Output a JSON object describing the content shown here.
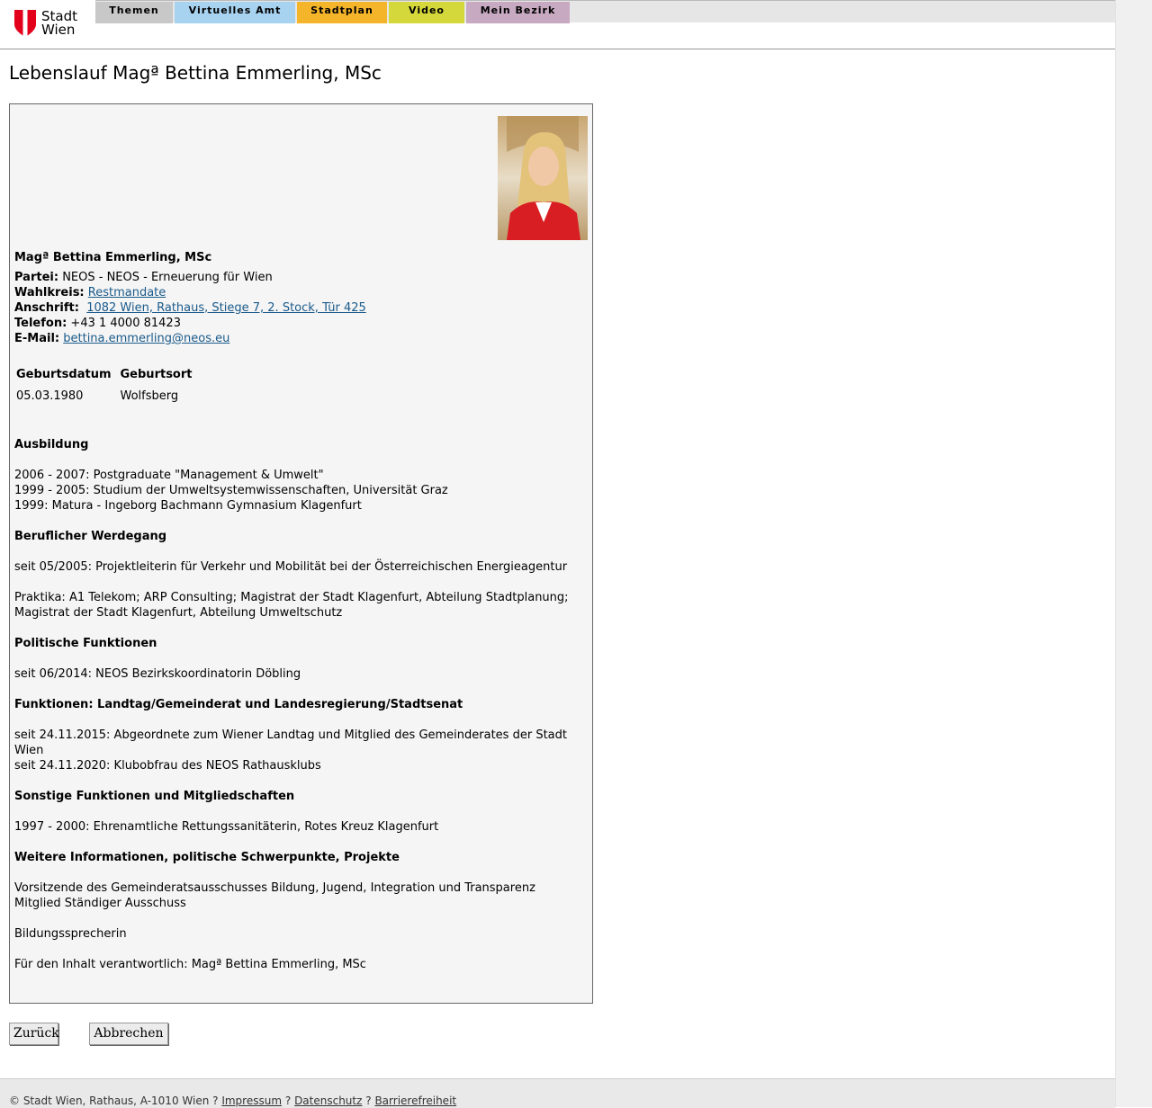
{
  "header": {
    "logo_text_line1": "Stadt",
    "logo_text_line2": "Wien",
    "tabs": [
      {
        "label": "Themen",
        "color": "#c8c8c8"
      },
      {
        "label": "Virtuelles Amt",
        "color": "#a8d3f0"
      },
      {
        "label": "Stadtplan",
        "color": "#f5b52a"
      },
      {
        "label": "Video",
        "color": "#d4d83a"
      },
      {
        "label": "Mein Bezirk",
        "color": "#c7a9c2"
      }
    ]
  },
  "page_title": "Lebenslauf Magª Bettina Emmerling, MSc",
  "profile": {
    "name": "Magª Bettina Emmerling, MSc",
    "partei_label": "Partei:",
    "partei_value": "NEOS - NEOS - Erneuerung für Wien",
    "wahlkreis_label": "Wahlkreis:",
    "wahlkreis_value": "Restmandate",
    "anschrift_label": "Anschrift:",
    "anschrift_value": "1082 Wien, Rathaus, Stiege 7, 2. Stock, Tür 425",
    "telefon_label": "Telefon:",
    "telefon_value": "+43 1 4000 81423",
    "email_label": "E-Mail:",
    "email_value": "bettina.emmerling@neos.eu"
  },
  "birth_table": {
    "headers": [
      "Geburtsdatum",
      "Geburtsort"
    ],
    "row": [
      "05.03.1980",
      "Wolfsberg"
    ]
  },
  "sections": {
    "ausbildung_title": "Ausbildung",
    "ausbildung": [
      "2006 - 2007: Postgraduate \"Management & Umwelt\"",
      "1999 - 2005: Studium der Umweltsystemwissenschaften, Universität Graz",
      "1999: Matura - Ingeborg Bachmann Gymnasium Klagenfurt"
    ],
    "beruf_title": "Beruflicher Werdegang",
    "beruf_1": "seit 05/2005: Projektleiterin für Verkehr und Mobilität bei der Österreichischen Energieagentur",
    "beruf_2": "Praktika: A1 Telekom; ARP Consulting; Magistrat der Stadt Klagenfurt, Abteilung Stadtplanung; Magistrat der Stadt Klagenfurt, Abteilung Umweltschutz",
    "politisch_title": "Politische Funktionen",
    "politisch_1": "seit 06/2014: NEOS Bezirkskoordinatorin Döbling",
    "funktionen_title": "Funktionen: Landtag/Gemeinderat und Landesregierung/Stadtsenat",
    "funktionen_1": "seit 24.11.2015: Abgeordnete zum Wiener Landtag und Mitglied des Gemeinderates der Stadt Wien",
    "funktionen_2": "seit 24.11.2020: Klubobfrau des NEOS Rathausklubs",
    "sonstige_title": "Sonstige Funktionen und Mitgliedschaften",
    "sonstige_1": "1997 - 2000: Ehrenamtliche Rettungssanitäterin, Rotes Kreuz Klagenfurt",
    "weitere_title": "Weitere Informationen, politische Schwerpunkte, Projekte",
    "weitere_1": "Vorsitzende des Gemeinderatsausschusses Bildung, Jugend, Integration und Transparenz",
    "weitere_2": "Mitglied Ständiger Ausschuss",
    "weitere_3": "Bildungssprecherin",
    "verantwortlich": "Für den Inhalt verantwortlich: Magª Bettina Emmerling, MSc"
  },
  "buttons": {
    "back": "Zurück",
    "cancel": "Abbrechen"
  },
  "footer": {
    "copyright": "© Stadt Wien, Rathaus, A-1010 Wien ?",
    "sep": "?",
    "impressum": "Impressum",
    "datenschutz": "Datenschutz",
    "barrierefreiheit": "Barrierefreiheit"
  }
}
